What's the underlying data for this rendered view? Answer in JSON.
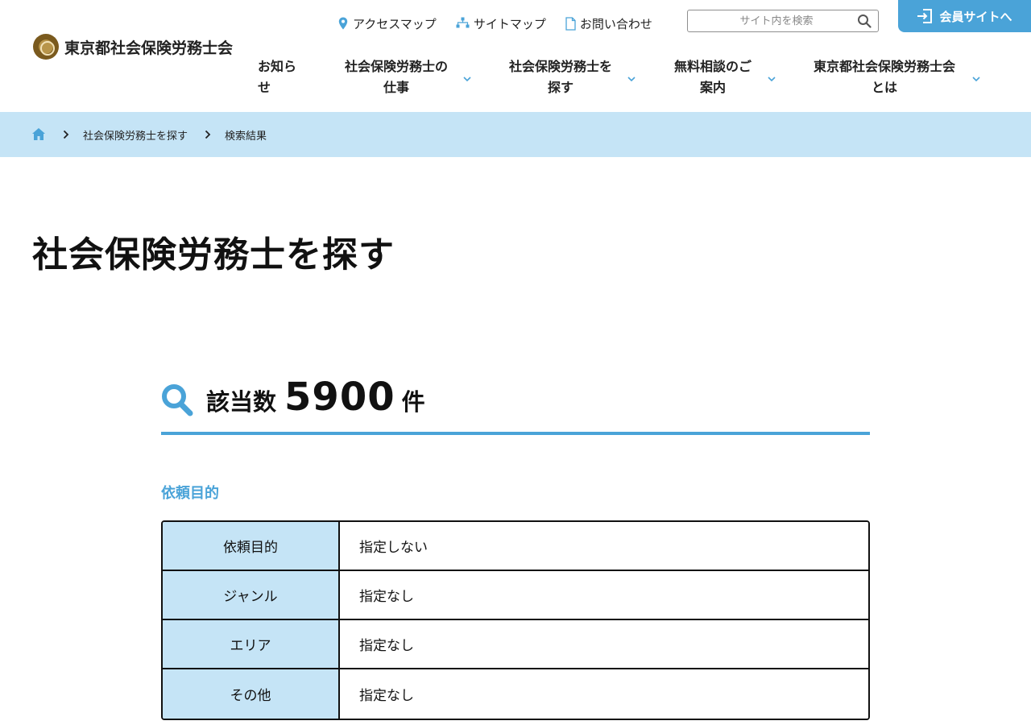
{
  "header": {
    "logo_text": "東京都社会保険労務士会",
    "util_links": [
      {
        "label": "アクセスマップ",
        "icon": "map-pin-icon"
      },
      {
        "label": "サイトマップ",
        "icon": "sitemap-icon"
      },
      {
        "label": "お問い合わせ",
        "icon": "document-icon"
      }
    ],
    "search": {
      "placeholder": "サイト内を検索"
    },
    "member_button": "会員サイトへ",
    "nav": [
      {
        "line1": "お知ら",
        "line2": "せ",
        "has_dropdown": false
      },
      {
        "line1": "社会保険労務士の",
        "line2": "仕事",
        "has_dropdown": true
      },
      {
        "line1": "社会保険労務士を",
        "line2": "探す",
        "has_dropdown": true
      },
      {
        "line1": "無料相談のご",
        "line2": "案内",
        "has_dropdown": true
      },
      {
        "line1": "東京都社会保険労務士会",
        "line2": "とは",
        "has_dropdown": true
      }
    ]
  },
  "breadcrumb": {
    "items": [
      "社会保険労務士を探す",
      "検索結果"
    ]
  },
  "page": {
    "title": "社会保険労務士を探す"
  },
  "results": {
    "label": "該当数",
    "count": "5900",
    "unit": "件"
  },
  "conditions": {
    "section_title": "依頼目的",
    "rows": [
      {
        "key": "依頼目的",
        "value": "指定しない"
      },
      {
        "key": "ジャンル",
        "value": "指定なし"
      },
      {
        "key": "エリア",
        "value": "指定なし"
      },
      {
        "key": "その他",
        "value": "指定なし"
      }
    ]
  },
  "colors": {
    "accent": "#4aa3d8",
    "light_blue_bg": "#c5e4f6",
    "text": "#111111"
  }
}
